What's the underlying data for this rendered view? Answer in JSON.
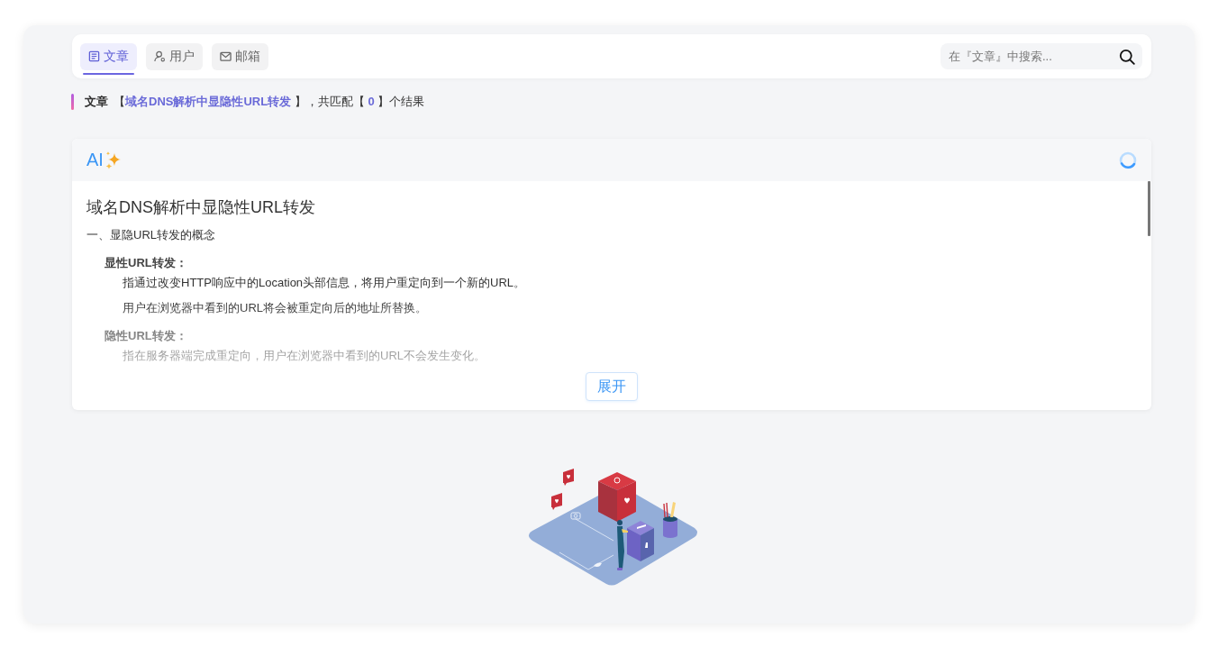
{
  "tabs": [
    {
      "label": "文章",
      "selected": true
    },
    {
      "label": "用户",
      "selected": false
    },
    {
      "label": "邮箱",
      "selected": false
    }
  ],
  "search": {
    "placeholder": "在『文章』中搜索..."
  },
  "result_summary": {
    "scope": "文章",
    "text": "【**域名DNS解析中显隐性URL转发** 】，共匹配【 **0** 】个结果"
  },
  "ai_panel": {
    "title": "AI",
    "loading": true,
    "heading": "域名DNS解析中显隐性URL转发",
    "sections": [
      {
        "title": "一、显隐URL转发的概念",
        "items": [
          {
            "term": "显性URL转发：",
            "lines": [
              "指通过改变HTTP响应中的Location头部信息，将用户重定向到一个新的URL。",
              "用户在浏览器中看到的URL将会被重定向后的地址所替换。"
            ]
          },
          {
            "term": "隐性URL转发：",
            "lines": [
              "指在服务器端完成重定向，用户在浏览器中看到的URL不会发生变化。"
            ]
          }
        ]
      }
    ],
    "expand_button": "展开"
  }
}
